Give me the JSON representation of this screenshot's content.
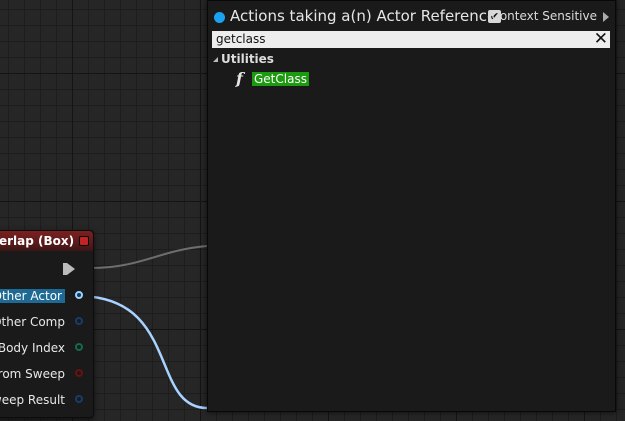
{
  "node": {
    "title": "erlap (Box)",
    "pins": [
      "Other Actor",
      "Other Comp",
      "Body Index",
      "From Sweep",
      "weep Result"
    ]
  },
  "menu": {
    "title": "Actions taking a(n) Actor Reference",
    "context_sensitive_label": "Context Sensitive",
    "context_sensitive_checked": "✔",
    "search_value": "getclass",
    "clear_glyph": "✕",
    "category": "Utilities",
    "function_glyph": "f",
    "results": [
      "GetClass"
    ]
  },
  "colors": {
    "accent": "#1aa2f0",
    "node_header": "#7a2020",
    "match_highlight": "#1c9a10",
    "wire": "#a8d2ff"
  }
}
